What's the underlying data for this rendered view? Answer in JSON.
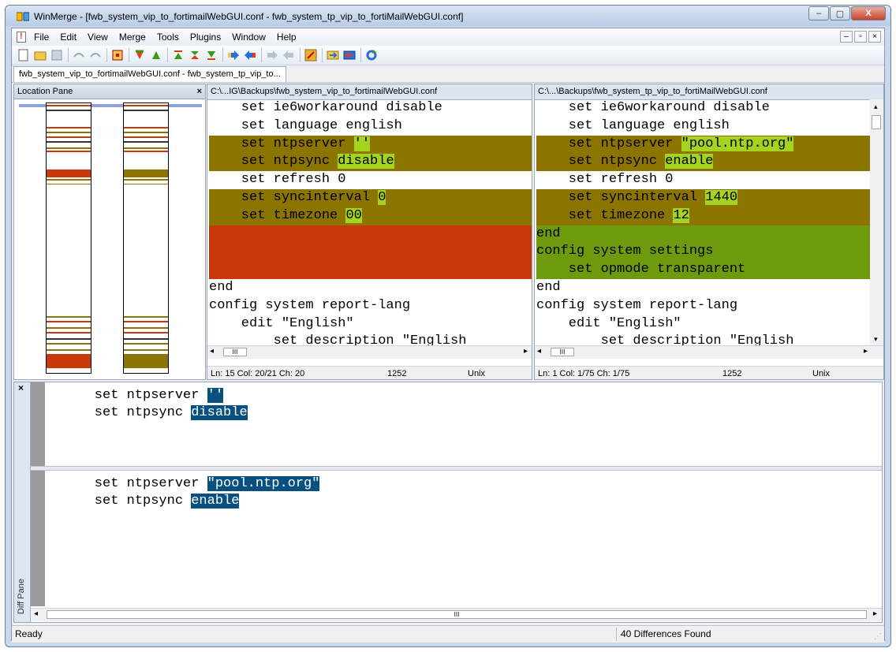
{
  "window": {
    "title": "WinMerge - [fwb_system_vip_to_fortimailWebGUI.conf - fwb_system_tp_vip_to_fortiMailWebGUI.conf]",
    "minimize": "–",
    "maximize": "▢",
    "close": "X"
  },
  "menu": [
    "File",
    "Edit",
    "View",
    "Merge",
    "Tools",
    "Plugins",
    "Window",
    "Help"
  ],
  "mdi": {
    "min": "–",
    "restore": "▫",
    "close": "×"
  },
  "tab": {
    "label": "fwb_system_vip_to_fortimailWebGUI.conf - fwb_system_tp_vip_to..."
  },
  "location_pane": {
    "title": "Location Pane",
    "close": "×"
  },
  "left_pane": {
    "path": "C:\\...IG\\Backups\\fwb_system_vip_to_fortimailWebGUI.conf",
    "lines": [
      {
        "type": "normal",
        "text": "    set ie6workaround disable"
      },
      {
        "type": "normal",
        "text": "    set language english"
      },
      {
        "type": "changed",
        "pre": "    set ntpserver ",
        "hl": "''",
        "post": ""
      },
      {
        "type": "changed",
        "pre": "    set ntpsync ",
        "hl": "disable",
        "post": ""
      },
      {
        "type": "normal",
        "text": "    set refresh 0"
      },
      {
        "type": "changed",
        "pre": "    set syncinterval ",
        "hl": "0",
        "post": ""
      },
      {
        "type": "changed",
        "pre": "    set timezone ",
        "hl": "00",
        "post": ""
      },
      {
        "type": "missing",
        "text": ""
      },
      {
        "type": "missing",
        "text": ""
      },
      {
        "type": "missing",
        "text": ""
      },
      {
        "type": "normal",
        "text": "end"
      },
      {
        "type": "normal",
        "text": "config system report-lang"
      },
      {
        "type": "normal",
        "text": "    edit \"English\""
      },
      {
        "type": "normal",
        "text": "        set description \"English"
      }
    ],
    "status": {
      "pos": "Ln: 15  Col: 20/21  Ch: 20",
      "cp": "1252",
      "eol": "Unix"
    }
  },
  "right_pane": {
    "path": "C:\\...\\Backups\\fwb_system_tp_vip_to_fortiMailWebGUI.conf",
    "lines": [
      {
        "type": "normal",
        "text": "    set ie6workaround disable"
      },
      {
        "type": "normal",
        "text": "    set language english"
      },
      {
        "type": "changed",
        "pre": "    set ntpserver ",
        "hl": "\"pool.ntp.org\"",
        "post": ""
      },
      {
        "type": "changed",
        "pre": "    set ntpsync ",
        "hl": "enable",
        "post": ""
      },
      {
        "type": "normal",
        "text": "    set refresh 0"
      },
      {
        "type": "changed",
        "pre": "    set syncinterval ",
        "hl": "1440",
        "post": ""
      },
      {
        "type": "changed",
        "pre": "    set timezone ",
        "hl": "12",
        "post": ""
      },
      {
        "type": "inserted",
        "text": "end"
      },
      {
        "type": "inserted",
        "text": "config system settings"
      },
      {
        "type": "inserted",
        "text": "    set opmode transparent"
      },
      {
        "type": "normal",
        "text": "end"
      },
      {
        "type": "normal",
        "text": "config system report-lang"
      },
      {
        "type": "normal",
        "text": "    edit \"English\""
      },
      {
        "type": "normal",
        "text": "        set description \"English"
      }
    ],
    "status": {
      "pos": "Ln: 1  Col: 1/75  Ch: 1/75",
      "cp": "1252",
      "eol": "Unix"
    }
  },
  "diff_pane": {
    "label": "Diff Pane",
    "close": "×",
    "top": [
      {
        "pre": "    set ntpserver ",
        "hl": "''"
      },
      {
        "pre": "    set ntpsync ",
        "hl": "disable"
      }
    ],
    "bottom": [
      {
        "pre": "    set ntpserver ",
        "hl": "\"pool.ntp.org\""
      },
      {
        "pre": "    set ntpsync ",
        "hl": "enable"
      }
    ]
  },
  "scroll_thumb": "III",
  "status": {
    "left": "Ready",
    "right": "40 Differences Found"
  },
  "colors": {
    "changed": "#8b7400",
    "inserted": "#6e9a0e",
    "missing": "#c8380a",
    "word": "#a5d420",
    "diffword": "#08507f"
  }
}
